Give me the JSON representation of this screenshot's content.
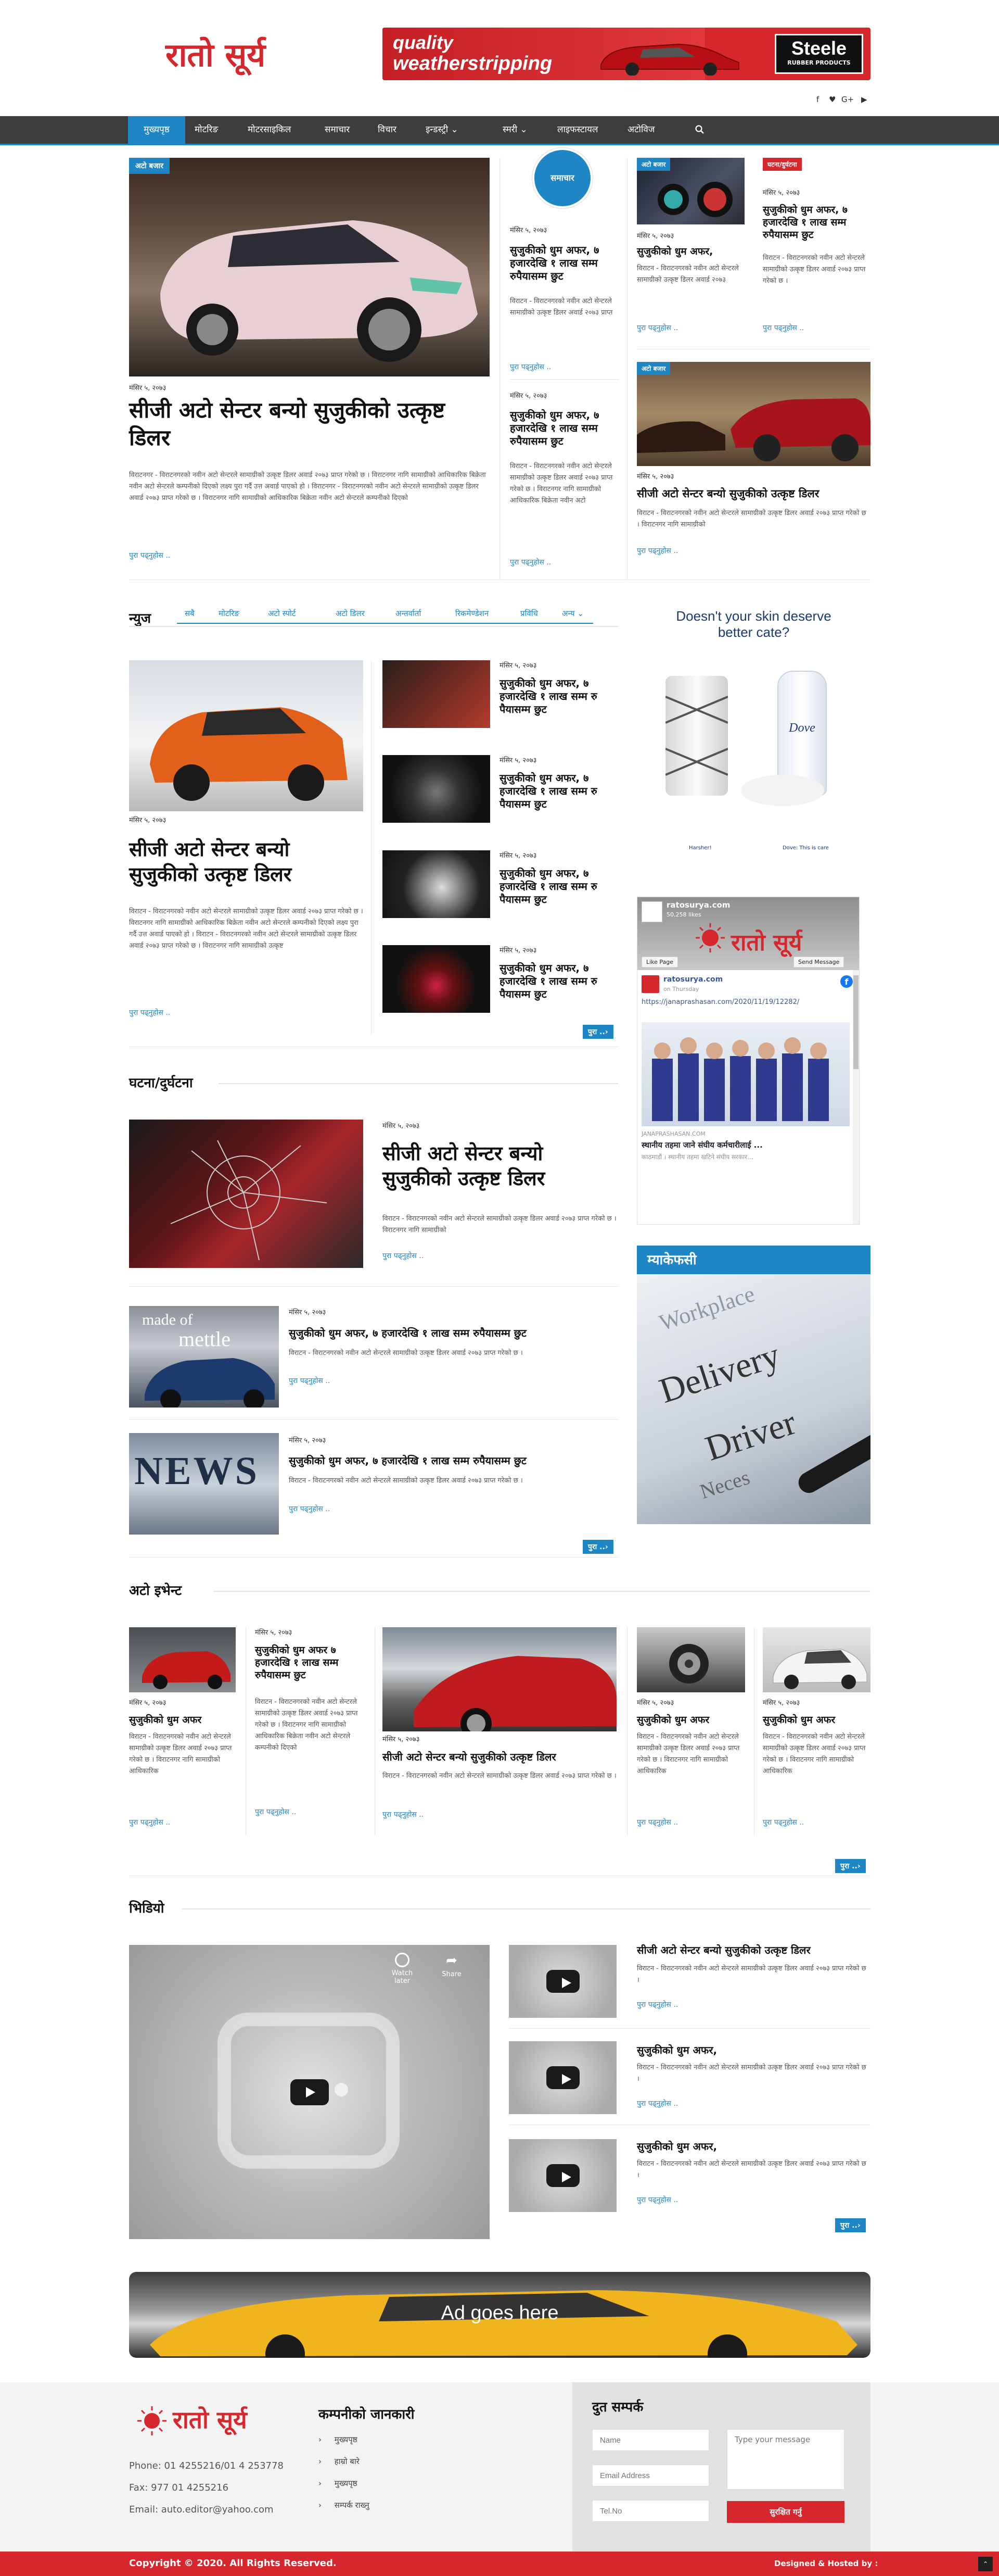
{
  "site": {
    "logo_text": "रातो सूर्य"
  },
  "top_ad": {
    "line1": "quality",
    "line2": "weatherstripping",
    "brand": "Steele",
    "brand_sub": "RUBBER PRODUCTS"
  },
  "social": {
    "icons": [
      "facebook-icon",
      "twitter-icon",
      "google-plus-icon",
      "youtube-icon"
    ],
    "glyphs": [
      "f",
      "♥",
      "G+",
      "▶"
    ]
  },
  "nav": {
    "items": [
      "मुख्यपृष्ठ",
      "मोटरिङ",
      "मोटरसाइकिल",
      "समाचार",
      "विचार",
      "इन्डस्ट्री ⌄",
      "स्मरी ⌄",
      "लाइफस्टायल",
      "अटोविज"
    ]
  },
  "hero": {
    "tag": "अटो बजार",
    "date": "मंसिर ५, २०७३",
    "headline": "सीजी अटो सेन्टर बन्यो सुजुकीको उत्कृष्ट डिलर",
    "body": "विराटनगर - विराटनगरको नवीन अटो सेन्टरले सामाग्रीको उत्कृष्ट डिलर अवार्ड २०७३ प्राप्त गरेको छ । विराटनगर नागि सामाग्रीको आधिकारिक बिक्रेता नवीन अटो सेन्टरले कम्पनीको दिएको लक्ष्य पुरा गर्दै उत्त अवार्ड पाएको हो । विराटनगर - विराटनगरको नवीन अटो सेन्टरले सामाग्रीको उत्कृष्ट डिलर अवार्ड २०७३ प्राप्त गरेको छ । विराटनगर नागि सामाग्रीको आधिकारिक बिक्रेता नवीन अटो सेन्टरले कम्पनीको दिएको",
    "more": "पुरा पढ्नुहोस .."
  },
  "samachar": {
    "tag": "समाचार",
    "items": [
      {
        "date": "मंसिर ५, २०७३",
        "title": "सुजुकीको धुम अफर, ७ हजारदेखि १ लाख सम्म रुपैयासम्म छुट",
        "body": "विराटन - विराटनगरको नवीन अटो सेन्टरले सामाग्रीको उत्कृष्ट डिलर अवार्ड २०७३ प्राप्त",
        "more": "पुरा पढ्नुहोस .."
      },
      {
        "date": "मंसिर ५, २०७३",
        "title": "सुजुकीको धुम अफर, ७ हजारदेखि १ लाख सम्म रुपैयासम्म छुट",
        "body": "विराटन - विराटनगरको नवीन अटो सेन्टरले सामाग्रीको उत्कृष्ट डिलर अवार्ड २०७३ प्राप्त गरेको छ । विराटनगर नागि सामाग्रीको आधिकारिक बिक्रेता नवीन अटो",
        "more": "पुरा पढ्नुहोस .."
      }
    ]
  },
  "right_top": {
    "a": {
      "tag": "अटो बजार",
      "date": "मंसिर ५, २०७३",
      "title": "सुजुकीको धुम अफर,",
      "body": "विराटन - विराटनगरको नवीन अटो सेन्टरले सामाग्रीको उत्कृष्ट डिलर अवार्ड २०७३",
      "more": "पुरा पढ्नुहोस .."
    },
    "b": {
      "tag": "घटना/दुर्घटना",
      "date": "मंसिर ५, २०७३",
      "title": "सुजुकीको धुम अफर, ७ हजारदेखि १ लाख सम्म रुपैयासम्म छुट",
      "body": "विराटन - विराटनगरको नवीन अटो सेन्टरले सामाग्रीको उत्कृष्ट डिलर अवार्ड २०७३ प्राप्त गरेको छ ।",
      "more": "पुरा पढ्नुहोस .."
    },
    "c": {
      "tag": "अटो बजार",
      "date": "मंसिर ५, २०७३",
      "title": "सीजी अटो सेन्टर बन्यो सुजुकीको उत्कृष्ट डिलर",
      "body": "विराटन - विराटनगरको नवीन अटो सेन्टरले सामाग्रीको उत्कृष्ट डिलर अवार्ड २०७३ प्राप्त गरेको छ । विराटनगर नागि सामाग्रीको",
      "more": "पुरा पढ्नुहोस .."
    }
  },
  "news": {
    "title": "न्युज",
    "tabs": [
      "सबै",
      "मोटरिङ",
      "अटो स्पोर्ट",
      "अटो डिलर",
      "अन्तर्वार्ता",
      "रिकमेण्डेशन",
      "प्रविधि",
      "अन्य ⌄"
    ],
    "main": {
      "date": "मंसिर ५, २०७३",
      "headline": "सीजी अटो सेन्टर बन्यो सुजुकीको उत्कृष्ट डिलर",
      "body": "विराटन - विराटनगरको नवीन अटो सेन्टरले सामाग्रीको उत्कृष्ट डिलर अवार्ड २०७३ प्राप्त गरेको छ । विराटनगर नागि सामाग्रीको आधिकारिक बिक्रेता नवीन अटो सेन्टरले कम्पनीको दिएको लक्ष्य पुरा गर्दै उत्त अवार्ड पाएको हो । विराटन - विराटनगरको नवीन अटो सेन्टरले सामाग्रीको उत्कृष्ट डिलर अवार्ड २०७३ प्राप्त गरेको छ । विराटनगर नागि सामाग्रीको उत्कृष्ट",
      "more": "पुरा पढ्नुहोस .."
    },
    "list": [
      {
        "date": "मंसिर ५, २०७३",
        "title": "सुजुकीको धुम अफर, ७ हजारदेखि १ लाख सम्म रु पैयासम्म छुट"
      },
      {
        "date": "मंसिर ५, २०७३",
        "title": "सुजुकीको धुम अफर, ७ हजारदेखि १ लाख सम्म रु पैयासम्म छुट"
      },
      {
        "date": "मंसिर ५, २०७३",
        "title": "सुजुकीको धुम अफर, ७ हजारदेखि १ लाख सम्म रु पैयासम्म छुट"
      },
      {
        "date": "मंसिर ५, २०७३",
        "title": "सुजुकीको धुम अफर, ७ हजारदेखि १ लाख सम्म रु पैयासम्म छुट"
      }
    ],
    "more_btn": "पुरा ..›"
  },
  "dove_ad": {
    "headline": "Doesn't your skin deserve better cate?",
    "left": "Harsher!",
    "right": "Dove: This is care"
  },
  "fb_widget": {
    "page_name": "ratosurya.com",
    "likes": "50,258 likes",
    "like_btn": "Like Page",
    "send_btn": "Send Message",
    "post_name": "ratosurya.com",
    "post_time": "on Thursday",
    "post_link": "https://janaprashasan.com/2020/11/19/12282/",
    "site": "JANAPRASHASAN.COM",
    "post_title": "स्थानीय तहमा जाने संघीय कर्मचारीलाई ...",
    "post_desc": "काठमाडौं । स्थानीय तहमा खटिने संघीय सरकार..."
  },
  "ghatana": {
    "title": "घटना/दुर्घटना",
    "main": {
      "date": "मंसिर ५, २०७३",
      "headline": "सीजी अटो सेन्टर बन्यो सुजुकीको उत्कृष्ट डिलर",
      "body": "विराटन - विराटनगरको नवीन अटो सेन्टरले सामाग्रीको उत्कृष्ट डिलर अवार्ड २०७३ प्राप्त गरेको छ । विराटनगर नागि सामाग्रीको",
      "more": "पुरा पढ्नुहोस .."
    },
    "list": [
      {
        "date": "मंसिर ५, २०७३",
        "title": "सुजुकीको धुम अफर, ७ हजारदेखि १ लाख सम्म रुपैयासम्म छुट",
        "body": "विराटन - विराटनगरको नवीन अटो सेन्टरले सामाग्रीको उत्कृष्ट डिलर अवार्ड २०७३ प्राप्त गरेको छ ।",
        "more": "पुरा पढ्नुहोस .."
      },
      {
        "date": "मंसिर ५, २०७३",
        "title": "सुजुकीको धुम अफर, ७ हजारदेखि १ लाख सम्म रुपैयासम्म छुट",
        "body": "विराटन - विराटनगरको नवीन अटो सेन्टरले सामाग्रीको उत्कृष्ट डिलर अवार्ड २०७३ प्राप्त गरेको छ ।",
        "more": "पुरा पढ्नुहोस .."
      }
    ],
    "more_btn": "पुरा ..›",
    "img_text1": "made of",
    "img_text2": "mettle",
    "img_text3": "NEWS"
  },
  "ad_side": {
    "title": "म्याकेफसी",
    "words": [
      "Workplace",
      "Delivery",
      "Driver",
      "Neces"
    ]
  },
  "auto_event": {
    "title": "अटो इभेन्ट",
    "cols": [
      {
        "date": "मंसिर ५, २०७३",
        "title": "सुजुकीको धुम अफर",
        "body": "विराटन - विराटनगरको नवीन अटो सेन्टरले सामाग्रीको उत्कृष्ट डिलर अवार्ड २०७३ प्राप्त गरेको छ । विराटनगर नागि सामाग्रीको आधिकारिक",
        "more": "पुरा पढ्नुहोस .."
      },
      {
        "date": "मंसिर ५, २०७३",
        "title": "सुजुकीको धुम अफर ७ हजारदेखि १ लाख सम्म रुपैयासम्म छुट",
        "body": "विराटन - विराटनगरको नवीन अटो सेन्टरले सामाग्रीको उत्कृष्ट डिलर अवार्ड २०७३ प्राप्त गरेको छ । विराटनगर नागि सामाग्रीको आधिकारिक बिक्रेता नवीन अटो सेन्टरले कम्पनीको दिएको",
        "more": "पुरा पढ्नुहोस .."
      },
      {
        "date": "मंसिर ५, २०७३",
        "title": "सीजी अटो सेन्टर बन्यो सुजुकीको उत्कृष्ट डिलर",
        "body": "विराटन - विराटनगरको नवीन अटो सेन्टरले सामाग्रीको उत्कृष्ट डिलर अवार्ड २०७३ प्राप्त गरेको छ ।",
        "more": "पुरा पढ्नुहोस .."
      },
      {
        "date": "मंसिर ५, २०७३",
        "title": "सुजुकीको धुम अफर",
        "body": "विराटन - विराटनगरको नवीन अटो सेन्टरले सामाग्रीको उत्कृष्ट डिलर अवार्ड २०७३ प्राप्त गरेको छ । विराटनगर नागि सामाग्रीको आधिकारिक",
        "more": "पुरा पढ्नुहोस .."
      },
      {
        "date": "मंसिर ५, २०७३",
        "title": "सुजुकीको धुम अफर",
        "body": "विराटन - विराटनगरको नवीन अटो सेन्टरले सामाग्रीको उत्कृष्ट डिलर अवार्ड २०७३ प्राप्त गरेको छ । विराटनगर नागि सामाग्रीको आधिकारिक",
        "more": "पुरा पढ्नुहोस .."
      }
    ],
    "more_btn": "पुरा ..›"
  },
  "video": {
    "title": "भिडियो",
    "player": {
      "watch_later": "Watch later",
      "share": "Share"
    },
    "list": [
      {
        "title": "सीजी अटो सेन्टर बन्यो सुजुकीको उत्कृष्ट डिलर",
        "body": "विराटन - विराटनगरको नवीन अटो सेन्टरले सामाग्रीको उत्कृष्ट डिलर अवार्ड २०७३ प्राप्त गरेको छ ।",
        "more": "पुरा पढ्नुहोस .."
      },
      {
        "title": "सुजुकीको धुम अफर,",
        "body": "विराटन - विराटनगरको नवीन अटो सेन्टरले सामाग्रीको उत्कृष्ट डिलर अवार्ड २०७३ प्राप्त गरेको छ ।",
        "more": "पुरा पढ्नुहोस .."
      },
      {
        "title": "सुजुकीको धुम अफर,",
        "body": "विराटन - विराटनगरको नवीन अटो सेन्टरले सामाग्रीको उत्कृष्ट डिलर अवार्ड २०७३ प्राप्त गरेको छ ।",
        "more": "पुरा पढ्नुहोस .."
      }
    ],
    "more_btn": "पुरा ..›"
  },
  "bottom_ad": {
    "text": "Ad goes here"
  },
  "footer": {
    "phone": "Phone: 01 4255216/01 4 253778",
    "fax": "Fax: 977 01 4255216",
    "email": "Email: auto.editor@yahoo.com",
    "company_title": "कम्पनीको जानकारी",
    "company_links": [
      "मुख्यपृष्ठ",
      "हाम्रो बारे",
      "मुख्यपृष्ठ",
      "सम्पर्क राख्नु"
    ],
    "contact_title": "दुत सम्पर्क",
    "name_ph": "Name",
    "email_ph": "Email Address",
    "tel_ph": "Tel.No",
    "msg_ph": "Type your message",
    "submit": "सुरक्षित गर्नु",
    "copyright": "Copyright © 2020. All Rights Reserved.",
    "designed": "Designed & Hosted by :"
  },
  "colors": {
    "accent": "#1f86c6",
    "brand": "#d6272c",
    "nav": "#3d3d3d"
  }
}
